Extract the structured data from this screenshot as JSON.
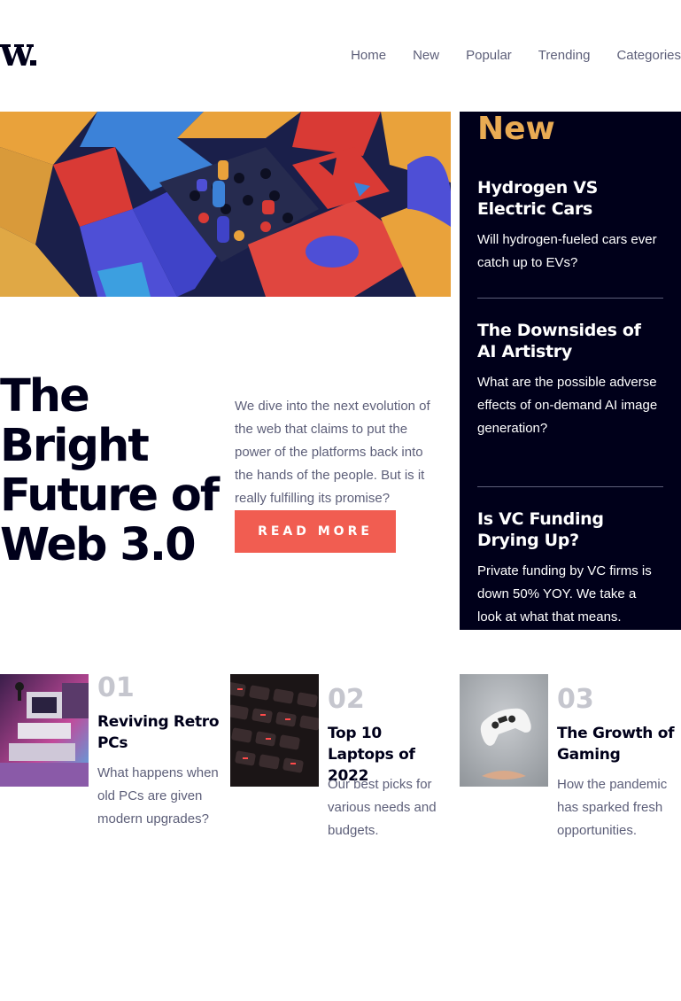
{
  "brand": {
    "logo_text": "W."
  },
  "nav": {
    "items": [
      "Home",
      "New",
      "Popular",
      "Trending",
      "Categories"
    ]
  },
  "hero": {
    "title": "The Bright Future of Web 3.0",
    "description": "We dive into the next evolution of the web that claims to put the power of the platforms back into the hands of the people. But is it really fulfilling its promise?",
    "cta_label": "READ MORE"
  },
  "new_section": {
    "heading": "New",
    "items": [
      {
        "title": "Hydrogen VS Electric Cars",
        "description": "Will hydrogen-fueled cars ever catch up to EVs?"
      },
      {
        "title": "The Downsides of AI Artistry",
        "description": "What are the possible adverse effects of on-demand AI image generation?"
      },
      {
        "title": "Is VC Funding Drying Up?",
        "description": "Private funding by VC firms is down 50% YOY. We take a look at what that means."
      }
    ]
  },
  "articles": [
    {
      "number": "01",
      "title": "Reviving Retro PCs",
      "description": "What happens when old PCs are given modern upgrades?",
      "image_icon": "retro-pc-image"
    },
    {
      "number": "02",
      "title": "Top 10 Laptops of 2022",
      "description": "Our best picks for various needs and budgets.",
      "image_icon": "laptop-keyboard-image"
    },
    {
      "number": "03",
      "title": "The Growth of Gaming",
      "description": "How the pandemic has sparked fresh opportunities.",
      "image_icon": "game-controller-image"
    }
  ],
  "colors": {
    "accent": "#f15d51",
    "highlight": "#e9ab53",
    "dark": "#00001a",
    "muted": "#5d5f79",
    "light_gray": "#c5c6ce"
  }
}
